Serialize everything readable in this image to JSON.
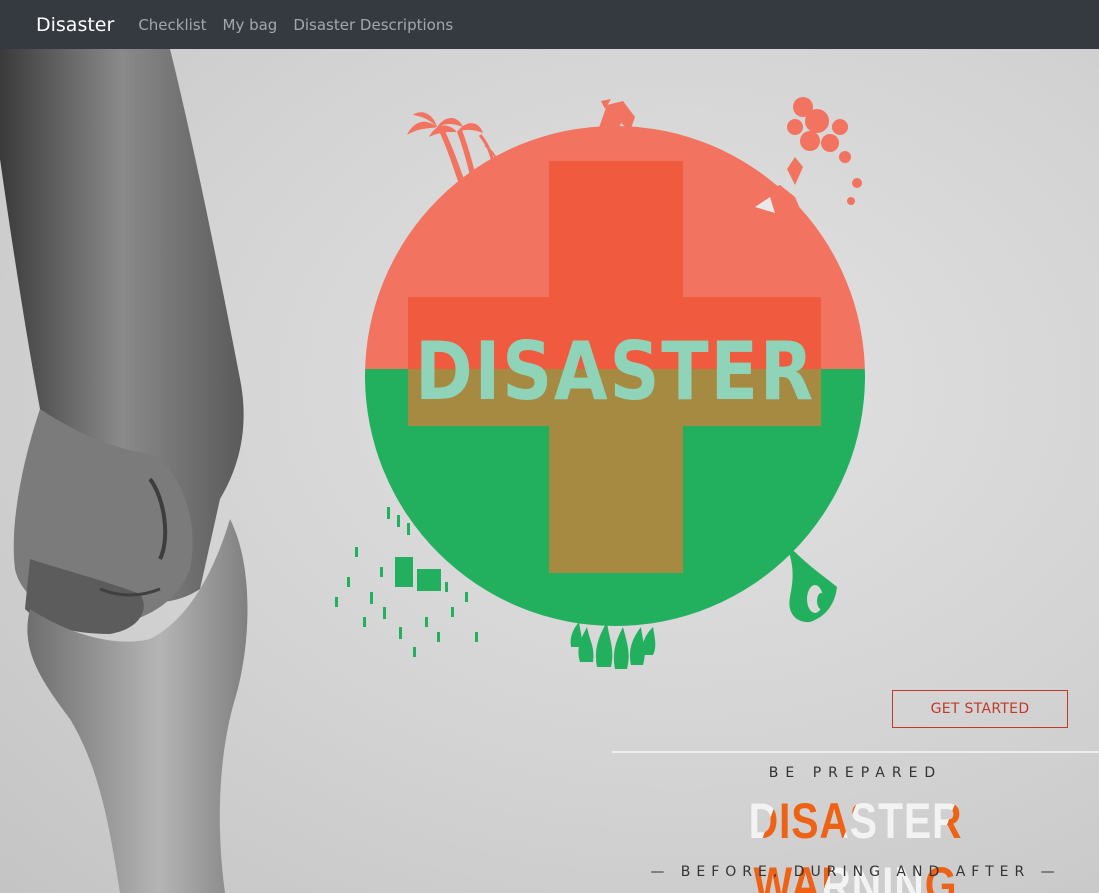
{
  "navbar": {
    "brand": "Disaster",
    "links": [
      "Checklist",
      "My bag",
      "Disaster Descriptions"
    ]
  },
  "logo": {
    "text": "DISASTER",
    "colors": {
      "top": "#f27360",
      "bottom": "#22b05f",
      "cross_top": "#f05a3e",
      "cross_bottom": "#a68a41",
      "text": "#8fd4b8"
    },
    "icons": [
      "palm-trees-storm-icon",
      "earthquake-icon",
      "volcano-icon",
      "flood-icon",
      "wildfire-icon",
      "tornado-icon"
    ]
  },
  "hero": {
    "button_label": "GET STARTED",
    "tagline": "BE PREPARED",
    "headline": "DISASTER WARNING",
    "subline": "— BEFORE, DURING AND AFTER —",
    "accent": "#ee6216"
  }
}
